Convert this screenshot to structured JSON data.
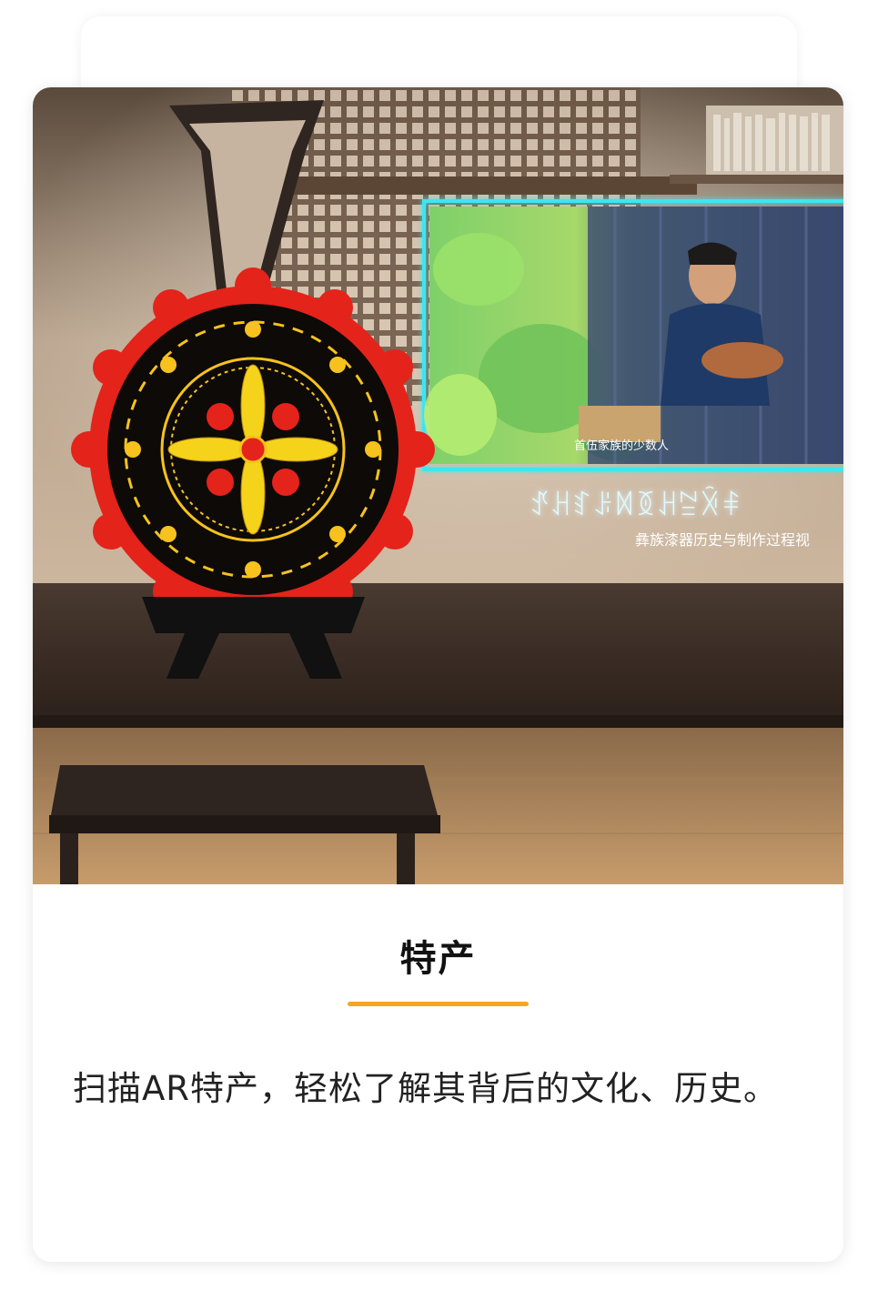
{
  "feature": {
    "title": "特产",
    "description": "扫描AR特产，轻松了解其背后的文化、历史。",
    "accent_color": "#f5a623"
  },
  "ar_overlay": {
    "video_subtitle": "首伍家族的少数人",
    "yi_script_caption": "ꀋꃅꆏꌠꉙꅉꃅꊂꋋꅪ",
    "caption": "彝族漆器历史与制作过程视",
    "frame_color": "#3ee6f0"
  }
}
